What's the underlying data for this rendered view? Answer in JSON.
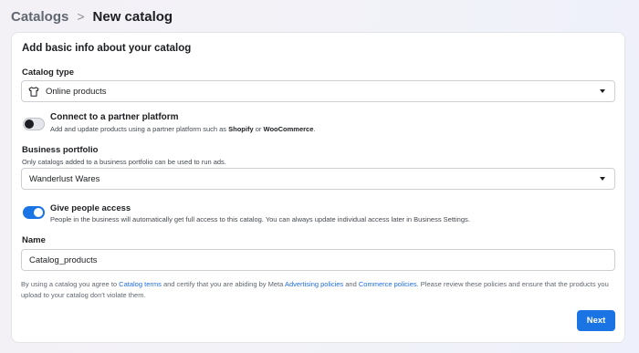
{
  "breadcrumb": {
    "parent": "Catalogs",
    "separator": ">",
    "current": "New catalog"
  },
  "card": {
    "title": "Add basic info about your catalog"
  },
  "catalog_type": {
    "label": "Catalog type",
    "icon": "tshirt-icon",
    "value": "Online products"
  },
  "partner": {
    "title": "Connect to a partner platform",
    "description_prefix": "Add and update products using a partner platform such as",
    "shopify": "Shopify",
    "or": "or",
    "woocommerce": "WooCommerce",
    "period": ".",
    "enabled": false
  },
  "business": {
    "label": "Business portfolio",
    "hint": "Only catalogs added to a business portfolio can be used to run ads.",
    "value": "Wanderlust Wares"
  },
  "access": {
    "title": "Give people access",
    "description": "People in the business will automatically get full access to this catalog. You can always update individual access later in Business Settings.",
    "enabled": true
  },
  "name": {
    "label": "Name",
    "value": "Catalog_products"
  },
  "footer": {
    "t1": "By using a catalog you agree to",
    "link_terms": "Catalog terms",
    "t2": "and certify that you are abiding by Meta",
    "link_ads": "Advertising policies",
    "t3": "and",
    "link_commerce": "Commerce policies",
    "t4": ". Please review these policies and ensure that the products you upload to your catalog don't violate them."
  },
  "actions": {
    "next": "Next"
  },
  "colors": {
    "primary": "#1b74e4",
    "link": "#216fdb"
  }
}
